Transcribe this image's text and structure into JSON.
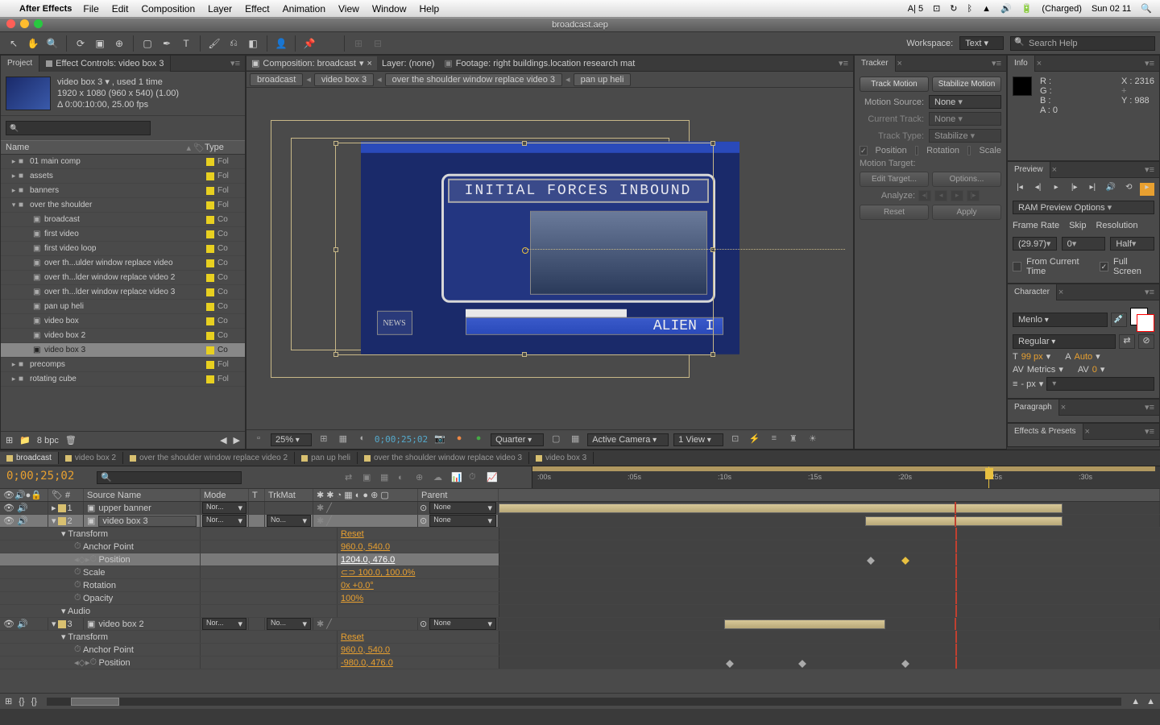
{
  "menubar": {
    "app": "After Effects",
    "items": [
      "File",
      "Edit",
      "Composition",
      "Layer",
      "Effect",
      "Animation",
      "View",
      "Window",
      "Help"
    ],
    "right": {
      "adobe": "A| 5",
      "battery": "(Charged)",
      "clock": "Sun 02 11"
    }
  },
  "window": {
    "title": "broadcast.aep"
  },
  "workspace": {
    "label": "Workspace:",
    "value": "Text",
    "search_placeholder": "Search Help"
  },
  "project": {
    "tab": "Project",
    "tab2": "Effect Controls: video box 3",
    "item_name": "video box 3 ▾ , used 1 time",
    "dims": "1920 x 1080  (960 x 540) (1.00)",
    "dur": "Δ 0:00:10:00, 25.00 fps",
    "cols": {
      "name": "Name",
      "type": "Type"
    },
    "rows": [
      {
        "indent": 0,
        "tw": "▸",
        "icon": "■",
        "name": "01 main comp",
        "type": "Fol"
      },
      {
        "indent": 0,
        "tw": "▸",
        "icon": "■",
        "name": "assets",
        "type": "Fol"
      },
      {
        "indent": 0,
        "tw": "▸",
        "icon": "■",
        "name": "banners",
        "type": "Fol"
      },
      {
        "indent": 0,
        "tw": "▾",
        "icon": "■",
        "name": "over the shoulder",
        "type": "Fol"
      },
      {
        "indent": 1,
        "tw": "",
        "icon": "▣",
        "name": "broadcast",
        "type": "Co"
      },
      {
        "indent": 1,
        "tw": "",
        "icon": "▣",
        "name": "first video",
        "type": "Co"
      },
      {
        "indent": 1,
        "tw": "",
        "icon": "▣",
        "name": "first video loop",
        "type": "Co"
      },
      {
        "indent": 1,
        "tw": "",
        "icon": "▣",
        "name": "over th...ulder window replace video",
        "type": "Co"
      },
      {
        "indent": 1,
        "tw": "",
        "icon": "▣",
        "name": "over th...lder window replace video 2",
        "type": "Co"
      },
      {
        "indent": 1,
        "tw": "",
        "icon": "▣",
        "name": "over th...lder window replace video 3",
        "type": "Co"
      },
      {
        "indent": 1,
        "tw": "",
        "icon": "▣",
        "name": "pan up heli",
        "type": "Co"
      },
      {
        "indent": 1,
        "tw": "",
        "icon": "▣",
        "name": "video box",
        "type": "Co"
      },
      {
        "indent": 1,
        "tw": "",
        "icon": "▣",
        "name": "video box 2",
        "type": "Co"
      },
      {
        "indent": 1,
        "tw": "",
        "icon": "▣",
        "name": "video box 3",
        "type": "Co",
        "sel": true
      },
      {
        "indent": 0,
        "tw": "▸",
        "icon": "■",
        "name": "precomps",
        "type": "Fol"
      },
      {
        "indent": 0,
        "tw": "▸",
        "icon": "■",
        "name": "rotating cube",
        "type": "Fol"
      }
    ],
    "bpc": "8 bpc"
  },
  "comp": {
    "tab": "Composition: broadcast",
    "tab2": "Layer: (none)",
    "tab3": "Footage: right buildings.location research mat",
    "bc": [
      "broadcast",
      "video box 3",
      "over the shoulder window replace video 3",
      "pan up heli"
    ],
    "headline": "INITIAL FORCES INBOUND",
    "ticker": "ALIEN I",
    "news": "NEWS",
    "zoom": "25%",
    "timecode": "0;00;25;02",
    "res": "Quarter",
    "cam": "Active Camera",
    "views": "1 View"
  },
  "tracker": {
    "tab": "Tracker",
    "btn1": "Track Motion",
    "btn2": "Stabilize Motion",
    "ms_label": "Motion Source:",
    "ms_val": "None",
    "ct_label": "Current Track:",
    "ct_val": "None",
    "tt_label": "Track Type:",
    "tt_val": "Stabilize",
    "pos": "Position",
    "rot": "Rotation",
    "scl": "Scale",
    "mt": "Motion Target:",
    "edit": "Edit Target...",
    "opt": "Options...",
    "an": "Analyze:",
    "reset": "Reset",
    "apply": "Apply"
  },
  "info": {
    "tab": "Info",
    "r": "R :",
    "g": "G :",
    "b": "B :",
    "a": "A :  0",
    "x": "X : 2316",
    "y": "Y : 988"
  },
  "preview": {
    "tab": "Preview",
    "ram": "RAM Preview Options",
    "fr_l": "Frame Rate",
    "sk_l": "Skip",
    "res_l": "Resolution",
    "fr": "(29.97)",
    "sk": "0",
    "res": "Half",
    "fct": "From Current Time",
    "fs": "Full Screen"
  },
  "character": {
    "tab": "Character",
    "font": "Menlo",
    "style": "Regular",
    "size": "99 px",
    "lead": "Auto",
    "kern": "Metrics",
    "track": "0",
    "px": "- px"
  },
  "paragraph": {
    "tab": "Paragraph"
  },
  "effects": {
    "tab": "Effects & Presets"
  },
  "timeline": {
    "tabs": [
      "broadcast",
      "video box 2",
      "over the shoulder window replace video 2",
      "pan up heli",
      "over the shoulder window replace video 3",
      "video box 3"
    ],
    "timecode": "0;00;25;02",
    "ruler": [
      "00s",
      "05s",
      "10s",
      "15s",
      "20s",
      "25s",
      "30s"
    ],
    "cols": {
      "sn": "Source Name",
      "mode": "Mode",
      "t": "T",
      "trk": "TrkMat",
      "parent": "Parent"
    },
    "layers": [
      {
        "n": "1",
        "name": "upper banner",
        "mode": "Nor...",
        "trk": "",
        "parent": "None"
      },
      {
        "n": "2",
        "name": "video box 3",
        "mode": "Nor...",
        "trk": "No...",
        "parent": "None",
        "sel": true,
        "open": true
      },
      {
        "n": "3",
        "name": "video box 2",
        "mode": "Nor...",
        "trk": "No...",
        "parent": "None",
        "open": true
      }
    ],
    "transform": "Transform",
    "reset": "Reset",
    "props2": [
      {
        "name": "Anchor Point",
        "val": "960.0, 540.0"
      },
      {
        "name": "Position",
        "val": "1204.0, 476.0",
        "kf": true,
        "sel": true
      },
      {
        "name": "Scale",
        "val": "⊂⊃ 100.0, 100.0%"
      },
      {
        "name": "Rotation",
        "val": "0x +0.0°"
      },
      {
        "name": "Opacity",
        "val": "100%"
      }
    ],
    "audio": "Audio",
    "props3": [
      {
        "name": "Anchor Point",
        "val": "960.0, 540.0"
      },
      {
        "name": "Position",
        "val": "-980.0, 476.0",
        "kf": true
      }
    ]
  }
}
